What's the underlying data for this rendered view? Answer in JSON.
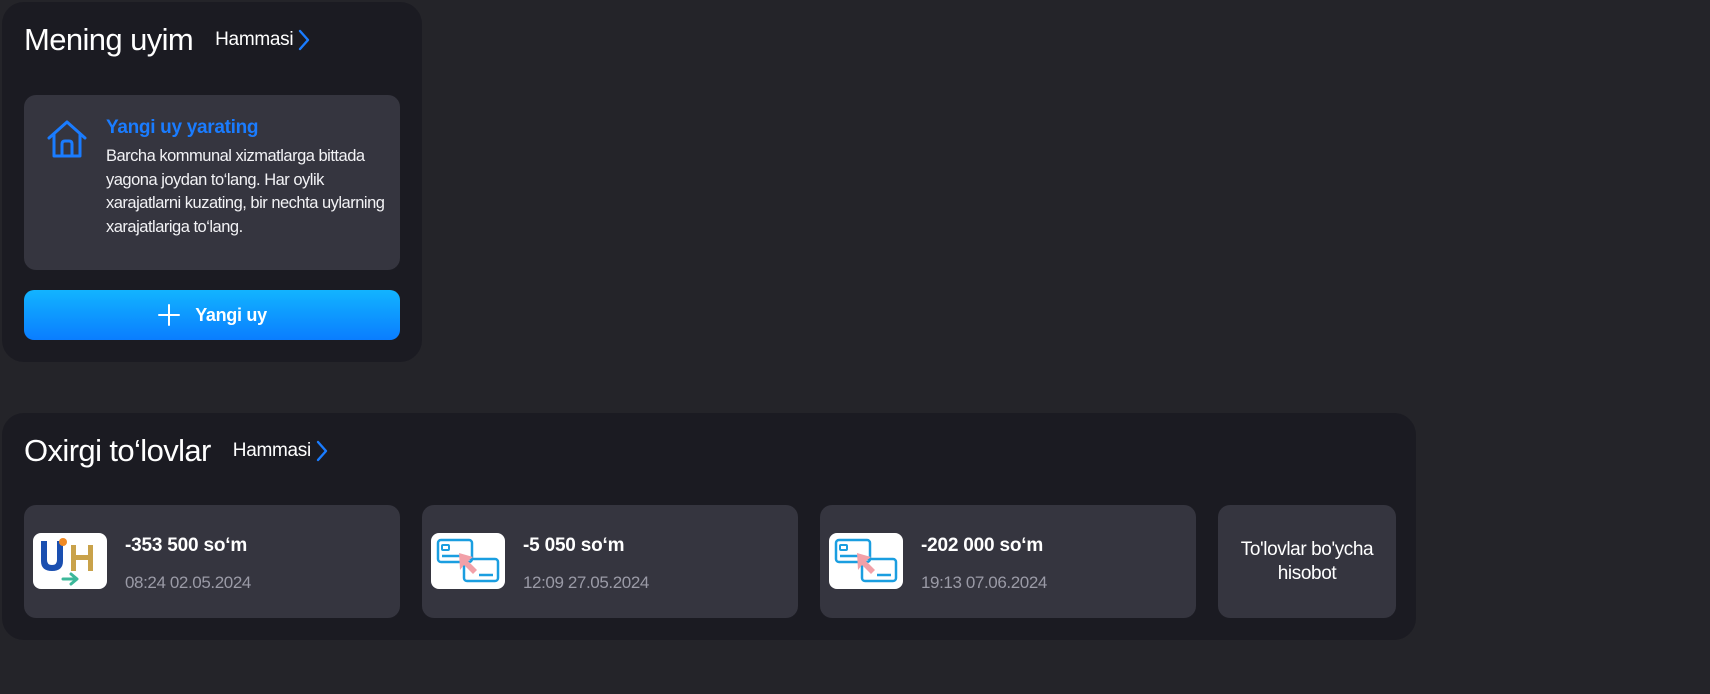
{
  "colors": {
    "accent": "#1a7cff",
    "panel_bg": "#1b1b22",
    "card_bg": "#35353f",
    "page_bg": "#242429"
  },
  "home": {
    "title": "Mening uyim",
    "see_all": "Hammasi",
    "card_title": "Yangi uy yarating",
    "card_text": "Barcha kommunal xizmatlarga bittada yagona joydan to‘lang. Har oylik xarajatlarni kuzating, bir nechta uylarning xarajatlariga to‘lang.",
    "card_icon": "house-icon",
    "button_label": "Yangi uy",
    "button_icon": "plus-icon"
  },
  "payments": {
    "title": "Oxirgi to‘lovlar",
    "see_all": "Hammasi",
    "items": [
      {
        "amount": "-353 500 so‘m",
        "datetime": "08:24 02.05.2024",
        "icon": "uzhydro-logo-icon"
      },
      {
        "amount": "-5 050 so‘m",
        "datetime": "12:09 27.05.2024",
        "icon": "card-transfer-icon"
      },
      {
        "amount": "-202 000 so‘m",
        "datetime": "19:13 07.06.2024",
        "icon": "card-transfer-icon"
      }
    ],
    "report_label": "To'lovlar bo'ycha hisobot"
  }
}
